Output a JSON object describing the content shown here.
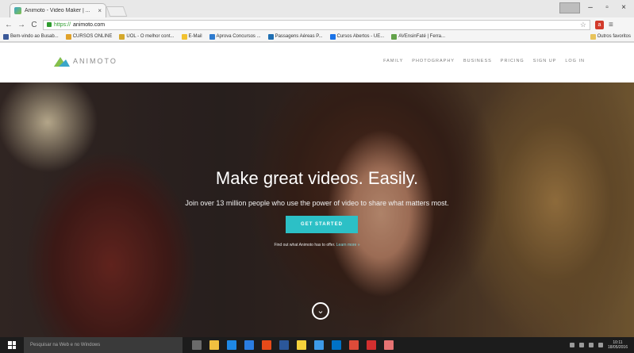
{
  "browser": {
    "tab_title": "Animoto - Video Maker | ...",
    "tab_close": "×",
    "url_scheme": "https://",
    "url_host": "animoto.com",
    "back": "←",
    "forward": "→",
    "reload": "C",
    "star": "☆",
    "ext_label": "a",
    "menu": "≡",
    "win_minimize": "–",
    "win_restore": "▫",
    "win_close": "×",
    "bookmarks": [
      {
        "label": "Bem-vindo ao Busab...",
        "color": "#3b5998"
      },
      {
        "label": "CURSOS ONLINE",
        "color": "#e0a22a"
      },
      {
        "label": "UOL - O melhor cont...",
        "color": "#d4a82c"
      },
      {
        "label": "E-Mail",
        "color": "#f2c230"
      },
      {
        "label": "Aprova Concursos ...",
        "color": "#2e7bcf"
      },
      {
        "label": "Passagens Aéreas P...",
        "color": "#1f6fb2"
      },
      {
        "label": "Cursos Abertos - UE...",
        "color": "#1a73e8"
      },
      {
        "label": "AVEnsinFaté | Ferra...",
        "color": "#63a24a"
      }
    ],
    "other_bookmarks": "Outros favoritos"
  },
  "site": {
    "logo_text": "ANIMOTO",
    "nav": [
      "FAMILY",
      "PHOTOGRAPHY",
      "BUSINESS",
      "PRICING",
      "SIGN UP",
      "LOG IN"
    ]
  },
  "hero": {
    "headline": "Make great videos. Easily.",
    "subline": "Join over 13 million people who use the power of video to share what matters most.",
    "cta": "GET STARTED",
    "note": "Find out what Animoto has to offer.",
    "note_link": "Learn more »",
    "scroll_icon": "⌄"
  },
  "taskbar": {
    "search_placeholder": "Pesquisar na Web e no Windows",
    "apps": [
      {
        "name": "task-view",
        "color": "#6a6a6a"
      },
      {
        "name": "file-explorer",
        "color": "#f0c040"
      },
      {
        "name": "edge",
        "color": "#1e88e5"
      },
      {
        "name": "store",
        "color": "#2a7de1"
      },
      {
        "name": "office",
        "color": "#e64a19"
      },
      {
        "name": "word",
        "color": "#2b579a"
      },
      {
        "name": "photos",
        "color": "#f4d23b"
      },
      {
        "name": "ie",
        "color": "#3d9be9"
      },
      {
        "name": "outlook",
        "color": "#0072c6"
      },
      {
        "name": "chrome",
        "color": "#dd4b39"
      },
      {
        "name": "acrobat",
        "color": "#d32f2f"
      },
      {
        "name": "paint",
        "color": "#e57373"
      }
    ],
    "clock_time": "10:11",
    "clock_date": "18/05/2016"
  },
  "colors": {
    "accent": "#2cc0c6"
  }
}
